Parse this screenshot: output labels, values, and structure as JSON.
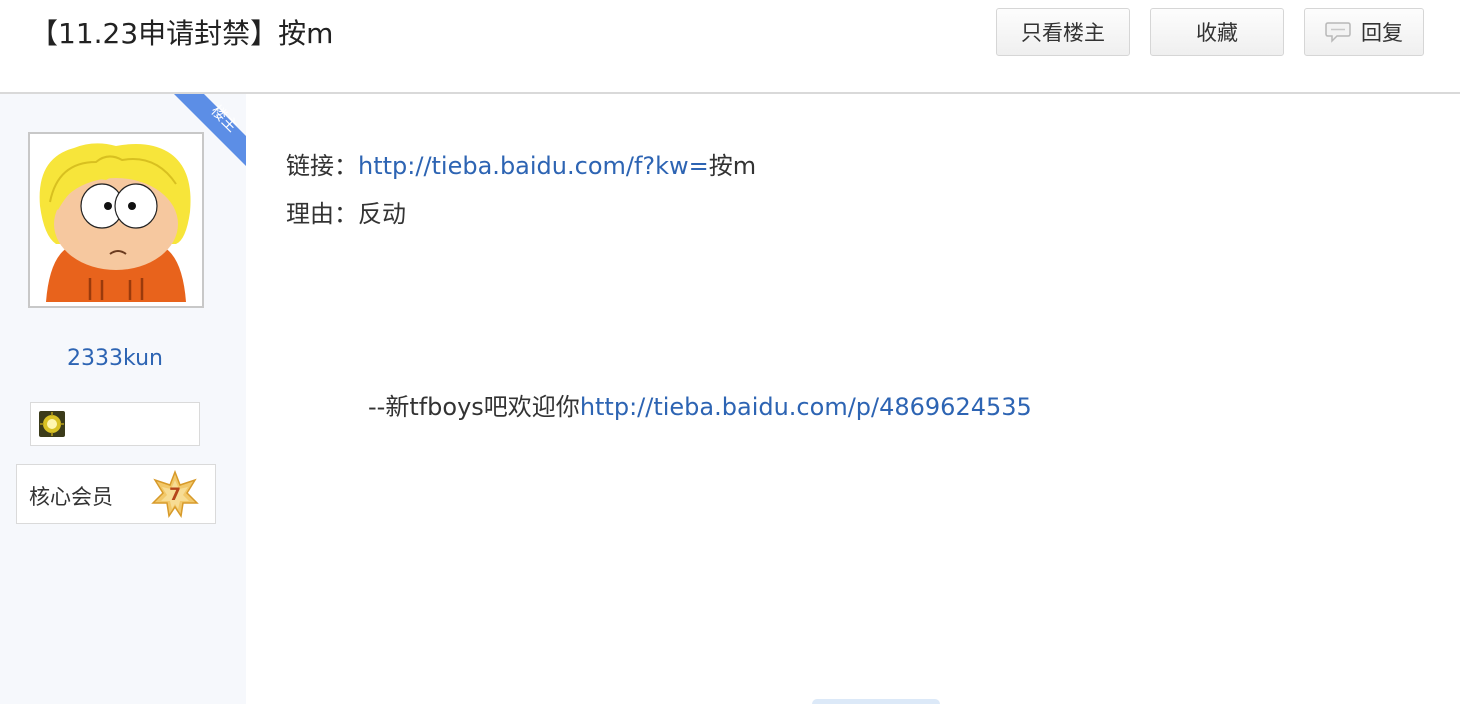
{
  "header": {
    "title": "【11.23申请封禁】按m",
    "buttons": {
      "only_host": "只看楼主",
      "collect": "收藏",
      "reply": "回复"
    }
  },
  "sidebar": {
    "host_tag": "楼主",
    "username": "2333kun",
    "member_label": "核心会员",
    "member_level": "7"
  },
  "post": {
    "link_label": "链接：",
    "link_url": "http://tieba.baidu.com/f?kw=",
    "link_suffix": "按m",
    "reason_label": "理由：",
    "reason_value": "反动",
    "sig_prefix": "--新tfboys吧欢迎你",
    "sig_url": "http://tieba.baidu.com/p/4869624535"
  },
  "colors": {
    "link": "#2d64b3",
    "host_tag": "#5c8ee6",
    "sidebar_bg": "#f6f8fc"
  }
}
